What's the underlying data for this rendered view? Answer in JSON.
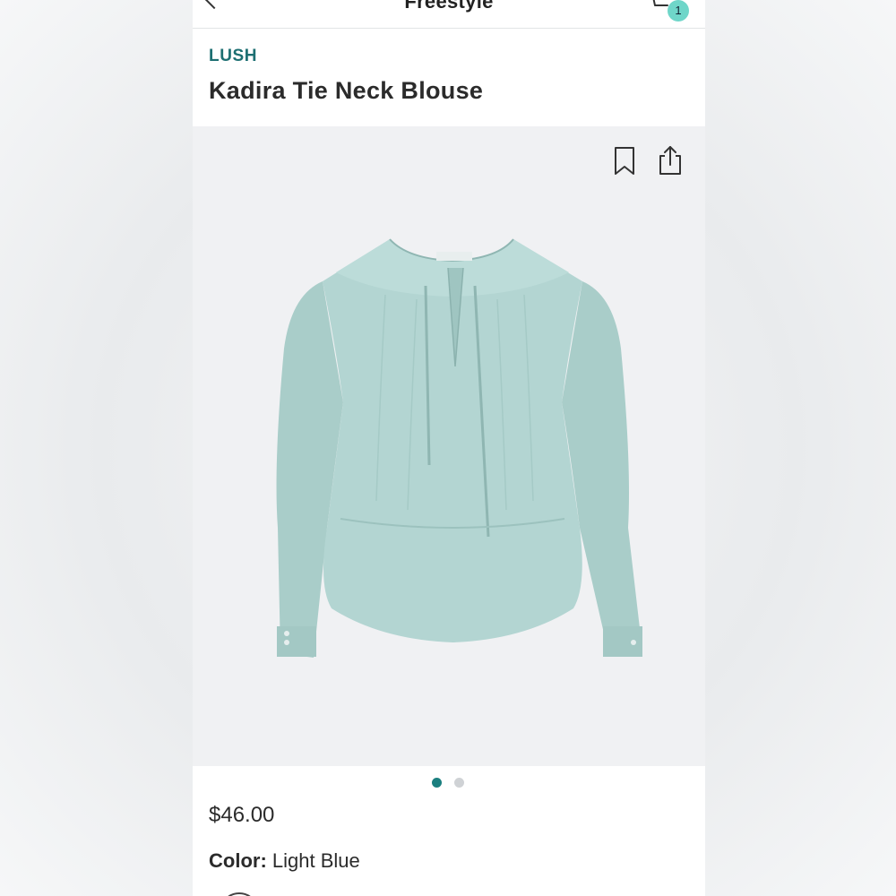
{
  "header": {
    "title": "Freestyle",
    "back_icon": "chevron-left-icon",
    "cart_icon": "cart-icon",
    "cart_count": "1",
    "badge_color": "#6fd6c9"
  },
  "product": {
    "brand": "LUSH",
    "name": "Kadira Tie Neck Blouse",
    "price": "$46.00",
    "color_label": "Color:",
    "color_value": "Light Blue",
    "brand_color": "#1d6f72",
    "garment_color": "#b3d5d2"
  },
  "gallery": {
    "bookmark_icon": "bookmark-icon",
    "share_icon": "share-icon",
    "image": "tie-neck-blouse-image",
    "dots": [
      {
        "active": true
      },
      {
        "active": false
      }
    ]
  }
}
